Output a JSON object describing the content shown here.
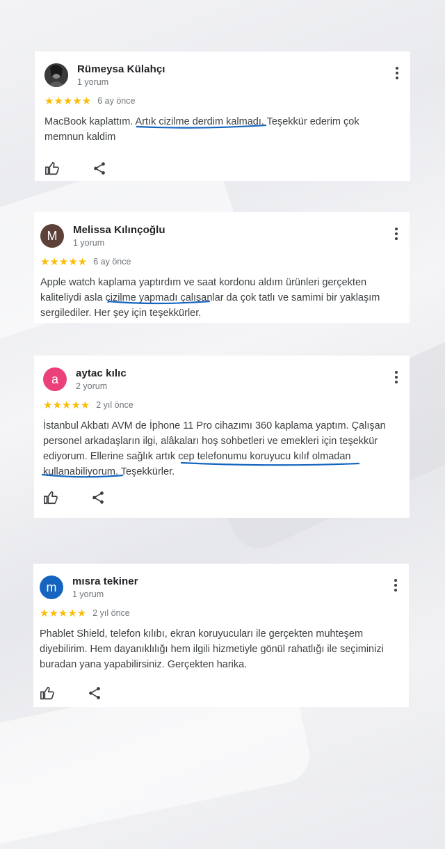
{
  "reviews": [
    {
      "name": "Rümeysa Külahçı",
      "count": "1 yorum",
      "stars": "★★★★★",
      "time": "6 ay önce",
      "text": "MacBook kaplattım. Artık cizilme derdim kalmadı. Teşekkür ederim çok memnun kaldim",
      "avatar_letter": "",
      "avatar_color": "#2b2b2b"
    },
    {
      "name": "Melissa Kılınçoğlu",
      "count": "1 yorum",
      "stars": "★★★★★",
      "time": "6 ay önce",
      "text": "Apple watch kaplama yaptırdım ve saat kordonu aldım ürünleri gerçekten kaliteliydi asla çizilme yapmadı çalışanlar da çok tatlı ve samimi bir yaklaşım sergilediler. Her şey için teşekkürler.",
      "avatar_letter": "M",
      "avatar_color": "#5d4037"
    },
    {
      "name": "aytac kılıc",
      "count": "2 yorum",
      "stars": "★★★★★",
      "time": "2 yıl önce",
      "text": "İstanbul Akbatı AVM de İphone 11 Pro cihazımı 360 kaplama yaptım. Çalışan personel arkadaşların ilgi, alâkaları hoş sohbetleri ve emekleri için teşekkür ediyorum. Ellerine sağlık artık cep telefonumu koruyucu kılıf olmadan kullanabiliyorum. Teşekkürler.",
      "avatar_letter": "a",
      "avatar_color": "#ec407a"
    },
    {
      "name": "mısra tekiner",
      "count": "1 yorum",
      "stars": "★★★★★",
      "time": "2 yıl önce",
      "text": "Phablet Shield, telefon kılıbı, ekran koruyucuları ile gerçekten muhteşem diyebilirim. Hem dayanıklılığı hem ilgili hizmetiyle gönül rahatlığı ile seçiminizi buradan yana yapabilirsiniz. Gerçekten harika.",
      "avatar_letter": "m",
      "avatar_color": "#1565c0"
    }
  ],
  "icons": {
    "like": "thumbs-up-icon",
    "share": "share-icon",
    "menu": "more-vert-icon"
  },
  "colors": {
    "star": "#fbbc04",
    "underline": "#1565c0"
  }
}
